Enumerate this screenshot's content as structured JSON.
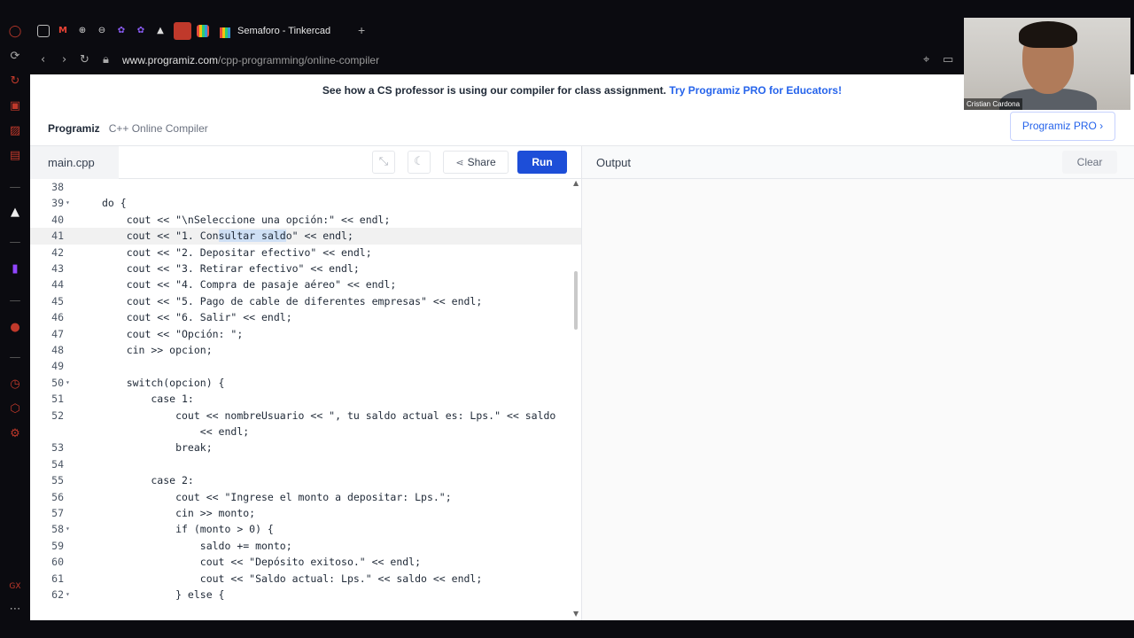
{
  "browser": {
    "active_tab_title": "Semaforo - Tinkercad",
    "new_tab": "+",
    "url_host": "www.programiz.com",
    "url_path": "/cpp-programming/online-compiler"
  },
  "banner": {
    "text": "See how a CS professor is using our compiler for class assignment.",
    "link": "Try Programiz PRO for Educators!"
  },
  "brand": {
    "logo": "Programiz",
    "subtitle": "C++ Online Compiler"
  },
  "pro_button": "Programiz PRO ›",
  "editor": {
    "file_name": "main.cpp",
    "share_label": "Share",
    "run_label": "Run"
  },
  "output": {
    "title": "Output",
    "clear_label": "Clear"
  },
  "webcam": {
    "name": "Cristian Cardona"
  },
  "code": [
    {
      "n": "38",
      "fold": false,
      "text": ""
    },
    {
      "n": "39",
      "fold": true,
      "text": "do {"
    },
    {
      "n": "40",
      "fold": false,
      "text": "    cout << \"\\nSeleccione una opción:\" << endl;"
    },
    {
      "n": "41",
      "fold": false,
      "text": "    cout << \"1. Consultar saldo\" << endl;"
    },
    {
      "n": "42",
      "fold": false,
      "text": "    cout << \"2. Depositar efectivo\" << endl;"
    },
    {
      "n": "43",
      "fold": false,
      "text": "    cout << \"3. Retirar efectivo\" << endl;"
    },
    {
      "n": "44",
      "fold": false,
      "text": "    cout << \"4. Compra de pasaje aéreo\" << endl;"
    },
    {
      "n": "45",
      "fold": false,
      "text": "    cout << \"5. Pago de cable de diferentes empresas\" << endl;"
    },
    {
      "n": "46",
      "fold": false,
      "text": "    cout << \"6. Salir\" << endl;"
    },
    {
      "n": "47",
      "fold": false,
      "text": "    cout << \"Opción: \";"
    },
    {
      "n": "48",
      "fold": false,
      "text": "    cin >> opcion;"
    },
    {
      "n": "49",
      "fold": false,
      "text": ""
    },
    {
      "n": "50",
      "fold": true,
      "text": "    switch(opcion) {"
    },
    {
      "n": "51",
      "fold": false,
      "text": "        case 1:"
    },
    {
      "n": "52",
      "fold": false,
      "text": "            cout << nombreUsuario << \", tu saldo actual es: Lps.\" << saldo"
    },
    {
      "n": "",
      "fold": false,
      "text": "                << endl;"
    },
    {
      "n": "53",
      "fold": false,
      "text": "            break;"
    },
    {
      "n": "54",
      "fold": false,
      "text": ""
    },
    {
      "n": "55",
      "fold": false,
      "text": "        case 2:"
    },
    {
      "n": "56",
      "fold": false,
      "text": "            cout << \"Ingrese el monto a depositar: Lps.\";"
    },
    {
      "n": "57",
      "fold": false,
      "text": "            cin >> monto;"
    },
    {
      "n": "58",
      "fold": true,
      "text": "            if (monto > 0) {"
    },
    {
      "n": "59",
      "fold": false,
      "text": "                saldo += monto;"
    },
    {
      "n": "60",
      "fold": false,
      "text": "                cout << \"Depósito exitoso.\" << endl;"
    },
    {
      "n": "61",
      "fold": false,
      "text": "                cout << \"Saldo actual: Lps.\" << saldo << endl;"
    },
    {
      "n": "62",
      "fold": true,
      "text": "            } else {"
    }
  ]
}
